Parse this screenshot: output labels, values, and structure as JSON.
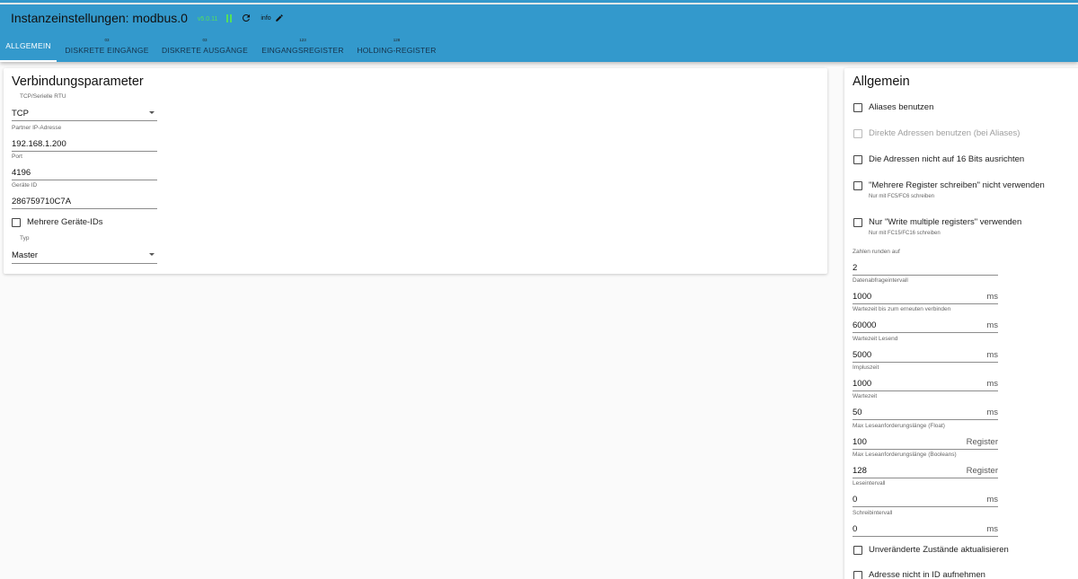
{
  "header": {
    "title": "Instanzeinstellungen: modbus.0",
    "version": "v5.0.11",
    "loglevel": "info",
    "accent_color": "#3399cc",
    "status_color": "#55e05a",
    "icons": {
      "pause": "pause-icon",
      "reload": "reload-icon",
      "edit": "pencil-icon"
    }
  },
  "tabs": [
    {
      "label": "ALLGEMEIN",
      "count": ""
    },
    {
      "label": "DISKRETE EINGÄNGE",
      "count": "03"
    },
    {
      "label": "DISKRETE AUSGÄNGE",
      "count": "03"
    },
    {
      "label": "EINGANGSREGISTER",
      "count": "123"
    },
    {
      "label": "HOLDING-REGISTER",
      "count": "128"
    }
  ],
  "connection": {
    "title": "Verbindungsparameter",
    "type": {
      "label": "TCP/Serielle RTU",
      "value": "TCP"
    },
    "ip": {
      "label": "Partner IP-Adresse",
      "value": "192.168.1.200"
    },
    "port": {
      "label": "Port",
      "value": "4196"
    },
    "device_id": {
      "label": "Geräte ID",
      "value": "286759710C7A"
    },
    "multi_device": {
      "label": "Mehrere Geräte-IDs"
    },
    "role": {
      "label": "Typ",
      "value": "Master"
    }
  },
  "general": {
    "title": "Allgemein",
    "aliases": {
      "label": "Aliases benutzen"
    },
    "direct": {
      "label": "Direkte Adressen benutzen (bei Aliases)"
    },
    "align": {
      "label": "Die Adressen nicht auf 16 Bits ausrichten"
    },
    "multi_write": {
      "label": "\"Mehrere Register schreiben\" nicht verwenden",
      "help": "Nur mit FC5/FC6 schreiben"
    },
    "only_multi": {
      "label": "Nur \"Write multiple registers\" verwenden",
      "help": "Nur mit FC15/FC16 schreiben"
    },
    "round": {
      "label": "Zahlen runden auf",
      "value": "2"
    },
    "poll": {
      "label": "Datenabfrageintervall",
      "value": "1000",
      "unit": "ms"
    },
    "reconnect": {
      "label": "Wartezeit bis zum erneuten verbinden",
      "value": "60000",
      "unit": "ms"
    },
    "read_timeout": {
      "label": "Wartezeit Lesend",
      "value": "5000",
      "unit": "ms"
    },
    "pulse": {
      "label": "Impluszeit",
      "value": "1000",
      "unit": "ms"
    },
    "wait": {
      "label": "Wartezeit",
      "value": "50",
      "unit": "ms"
    },
    "max_float": {
      "label": "Max Leseanforderungslänge (Float)",
      "value": "100",
      "unit": "Register"
    },
    "max_bool": {
      "label": "Max Leseanforderungslänge (Booleans)",
      "value": "128",
      "unit": "Register"
    },
    "read_interval": {
      "label": "Leseintervall",
      "value": "0",
      "unit": "ms"
    },
    "write_interval": {
      "label": "Schreibintervall",
      "value": "0",
      "unit": "ms"
    },
    "update_unchanged": {
      "label": "Unveränderte Zustände aktualisieren"
    },
    "no_address": {
      "label": "Adresse nicht in ID aufnehmen"
    }
  }
}
